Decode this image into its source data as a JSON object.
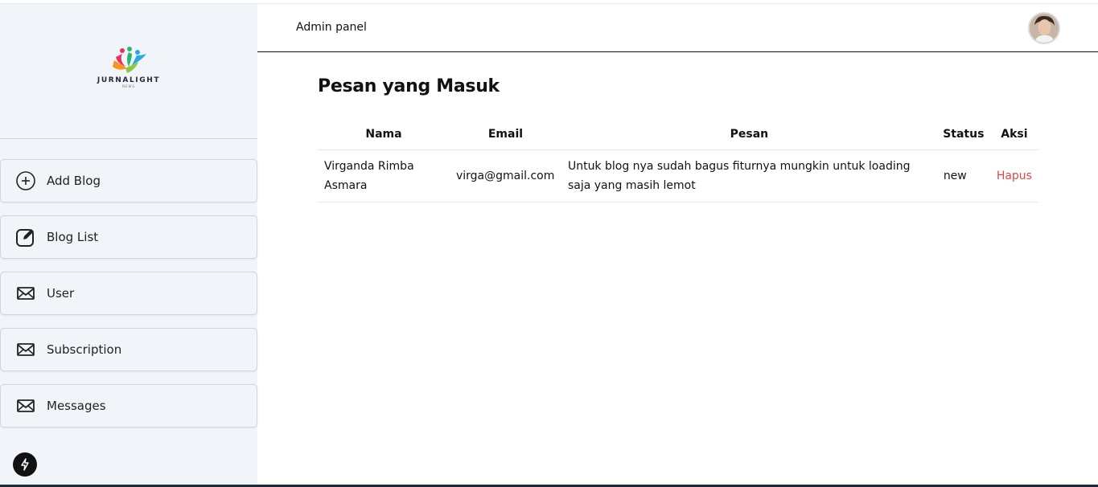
{
  "sidebar": {
    "logo_text": "JURNALIGHT",
    "logo_sub": "NEWS",
    "items": [
      {
        "label": "Add Blog",
        "icon": "plus-circle-icon"
      },
      {
        "label": "Blog List",
        "icon": "edit-icon"
      },
      {
        "label": "User",
        "icon": "mail-icon"
      },
      {
        "label": "Subscription",
        "icon": "mail-icon"
      },
      {
        "label": "Messages",
        "icon": "mail-icon"
      }
    ],
    "bolt_icon": "bolt-icon"
  },
  "header": {
    "title": "Admin panel",
    "avatar": "user-avatar"
  },
  "main": {
    "title": "Pesan yang Masuk",
    "columns": [
      "Nama",
      "Email",
      "Pesan",
      "Status",
      "Aksi"
    ],
    "rows": [
      {
        "nama": "Virganda Rimba Asmara",
        "email": "virga@gmail.com",
        "pesan": "Untuk blog nya sudah bagus fiturnya mungkin untuk loading saja yang masih lemot",
        "status": "new",
        "aksi": "Hapus"
      }
    ]
  },
  "colors": {
    "sidebar_bg": "#f1f4f8",
    "danger": "#e04848"
  }
}
